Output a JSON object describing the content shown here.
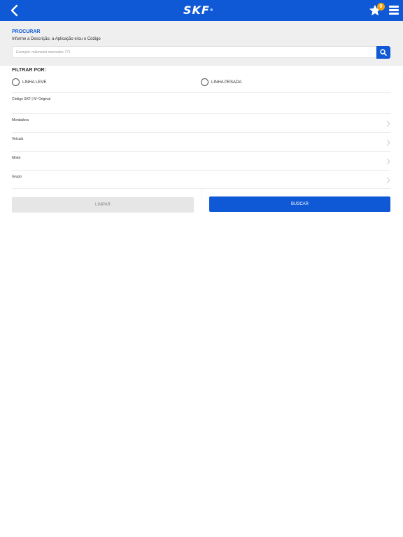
{
  "header": {
    "logo_text": "SKF",
    "logo_reg": "®",
    "favorites_count": "0",
    "accent_color": "#0f58d6",
    "badge_color": "#f3a20d",
    "icons": [
      "back-arrow-icon",
      "star-icon",
      "hamburger-menu-icon"
    ]
  },
  "search": {
    "title": "PROCURAR",
    "subtitle": "Informe a Descrição, a Aplicação e/ou o Código",
    "placeholder": "Exemplo: rolamento mercedes 771",
    "value": "",
    "button_icon": "search-icon"
  },
  "filters": {
    "title": "FILTRAR POR:",
    "radios": [
      {
        "label": "LINHA LEVE",
        "selected": false
      },
      {
        "label": "LINHA PESADA",
        "selected": false
      }
    ],
    "fields": [
      {
        "label": "Código SKF | Nº Original",
        "has_chevron": false
      },
      {
        "label": "Montadora",
        "has_chevron": true
      },
      {
        "label": "Veículo",
        "has_chevron": true
      },
      {
        "label": "Motor",
        "has_chevron": true
      },
      {
        "label": "Grupo",
        "has_chevron": true
      }
    ]
  },
  "actions": {
    "clear_label": "LIMPAR",
    "search_label": "BUSCAR"
  }
}
